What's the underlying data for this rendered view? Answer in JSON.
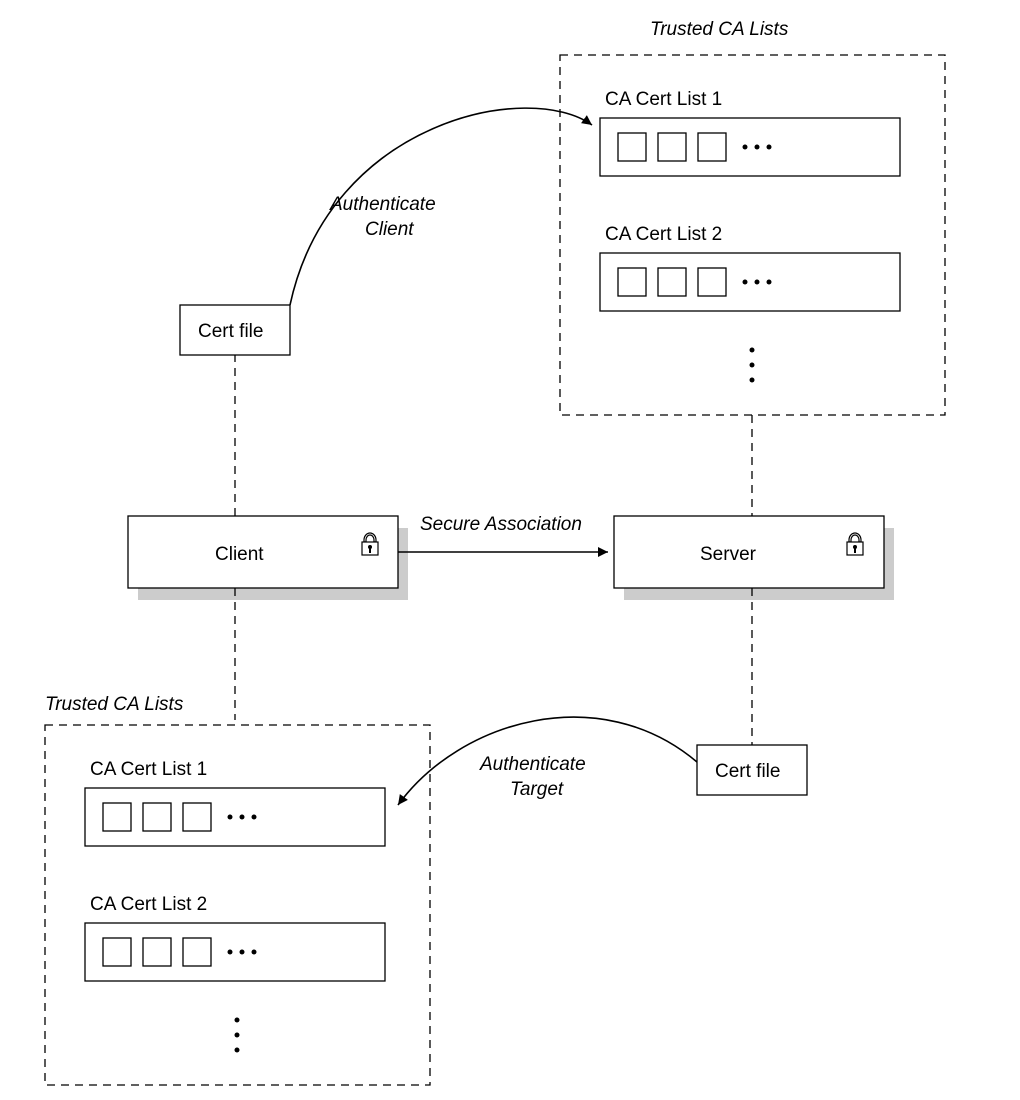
{
  "topRight": {
    "title": "Trusted CA Lists",
    "list1": "CA Cert List 1",
    "list2": "CA Cert List 2"
  },
  "bottomLeft": {
    "title": "Trusted CA Lists",
    "list1": "CA Cert List 1",
    "list2": "CA Cert List 2"
  },
  "client": {
    "certFile": "Cert file",
    "label": "Client"
  },
  "server": {
    "certFile": "Cert file",
    "label": "Server"
  },
  "arrows": {
    "authClient": "Authenticate",
    "authClient2": "Client",
    "secure": "Secure Association",
    "authTarget": "Authenticate",
    "authTarget2": "Target"
  }
}
